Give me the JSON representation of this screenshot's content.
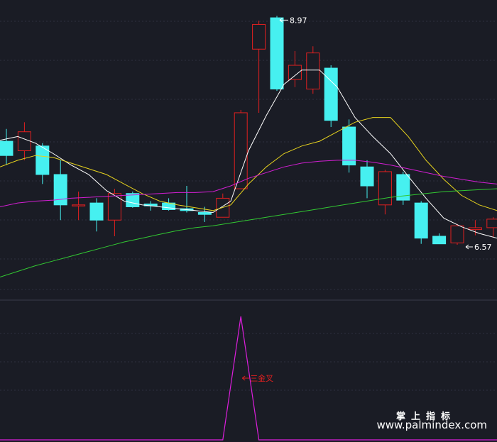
{
  "chart_data": {
    "type": "candlestick",
    "price_range": [
      6.0,
      9.1
    ],
    "candles": [
      {
        "o": 7.65,
        "h": 7.78,
        "l": 7.4,
        "c": 7.5
      },
      {
        "o": 7.55,
        "h": 7.85,
        "l": 7.45,
        "c": 7.75
      },
      {
        "o": 7.6,
        "h": 7.63,
        "l": 7.2,
        "c": 7.3
      },
      {
        "o": 7.3,
        "h": 7.45,
        "l": 6.82,
        "c": 6.98
      },
      {
        "o": 6.98,
        "h": 7.12,
        "l": 6.82,
        "c": 6.98
      },
      {
        "o": 7.0,
        "h": 7.05,
        "l": 6.7,
        "c": 6.82
      },
      {
        "o": 6.82,
        "h": 7.15,
        "l": 6.65,
        "c": 7.1
      },
      {
        "o": 7.1,
        "h": 7.12,
        "l": 6.95,
        "c": 6.96
      },
      {
        "o": 6.99,
        "h": 7.02,
        "l": 6.92,
        "c": 6.97
      },
      {
        "o": 7.0,
        "h": 7.05,
        "l": 6.92,
        "c": 6.93
      },
      {
        "o": 6.94,
        "h": 7.18,
        "l": 6.9,
        "c": 6.92
      },
      {
        "o": 6.9,
        "h": 6.96,
        "l": 6.8,
        "c": 6.88
      },
      {
        "o": 6.85,
        "h": 7.1,
        "l": 6.85,
        "c": 7.05
      },
      {
        "o": 7.15,
        "h": 7.98,
        "l": 7.15,
        "c": 7.95
      },
      {
        "o": 8.62,
        "h": 8.92,
        "l": 7.95,
        "c": 8.88
      },
      {
        "o": 8.95,
        "h": 8.97,
        "l": 8.18,
        "c": 8.2
      },
      {
        "o": 8.3,
        "h": 8.6,
        "l": 8.22,
        "c": 8.45
      },
      {
        "o": 8.2,
        "h": 8.65,
        "l": 8.15,
        "c": 8.58
      },
      {
        "o": 8.42,
        "h": 8.45,
        "l": 7.8,
        "c": 7.87
      },
      {
        "o": 7.8,
        "h": 7.88,
        "l": 7.32,
        "c": 7.4
      },
      {
        "o": 7.38,
        "h": 7.45,
        "l": 7.05,
        "c": 7.18
      },
      {
        "o": 6.98,
        "h": 7.35,
        "l": 6.88,
        "c": 7.33
      },
      {
        "o": 7.3,
        "h": 7.33,
        "l": 6.98,
        "c": 7.03
      },
      {
        "o": 7.0,
        "h": 7.02,
        "l": 6.57,
        "c": 6.63
      },
      {
        "o": 6.65,
        "h": 6.68,
        "l": 6.57,
        "c": 6.57
      },
      {
        "o": 6.58,
        "h": 6.78,
        "l": 6.56,
        "c": 6.76
      },
      {
        "o": 6.72,
        "h": 6.82,
        "l": 6.66,
        "c": 6.74
      },
      {
        "o": 6.74,
        "h": 6.85,
        "l": 6.64,
        "c": 6.83
      }
    ],
    "ma_lines": [
      {
        "color": "#ffffff",
        "values": [
          7.66,
          7.7,
          7.63,
          7.52,
          7.4,
          7.3,
          7.13,
          7.02,
          6.98,
          6.96,
          6.94,
          6.92,
          6.9,
          7.02,
          7.55,
          7.92,
          8.25,
          8.4,
          8.4,
          8.22,
          7.9,
          7.7,
          7.52,
          7.28,
          7.05,
          6.84,
          6.75,
          6.68,
          6.63
        ]
      },
      {
        "color": "#e6d21e",
        "values": [
          7.38,
          7.45,
          7.5,
          7.48,
          7.42,
          7.36,
          7.3,
          7.2,
          7.1,
          7.02,
          6.98,
          6.95,
          6.92,
          6.98,
          7.2,
          7.38,
          7.52,
          7.6,
          7.65,
          7.75,
          7.85,
          7.9,
          7.9,
          7.7,
          7.45,
          7.25,
          7.08,
          6.98,
          6.92
        ]
      },
      {
        "color": "#d21ed2",
        "values": [
          6.96,
          7.0,
          7.02,
          7.03,
          7.05,
          7.06,
          7.07,
          7.08,
          7.09,
          7.1,
          7.11,
          7.11,
          7.12,
          7.18,
          7.26,
          7.32,
          7.38,
          7.42,
          7.44,
          7.45,
          7.45,
          7.43,
          7.4,
          7.36,
          7.32,
          7.28,
          7.25,
          7.22,
          7.2
        ]
      },
      {
        "color": "#32c832",
        "values": [
          6.22,
          6.28,
          6.34,
          6.39,
          6.44,
          6.49,
          6.54,
          6.59,
          6.63,
          6.67,
          6.71,
          6.74,
          6.76,
          6.79,
          6.82,
          6.85,
          6.88,
          6.91,
          6.94,
          6.97,
          7.0,
          7.03,
          7.06,
          7.08,
          7.1,
          7.12,
          7.13,
          7.14,
          7.15
        ]
      }
    ],
    "annotations": {
      "high_label": "8.97",
      "low_label": "6.57"
    },
    "indicator": {
      "values": [
        0,
        0,
        0,
        0,
        0,
        0,
        0,
        0,
        0,
        0,
        0,
        0,
        0,
        1,
        0,
        0,
        0,
        0,
        0,
        0,
        0,
        0,
        0,
        0,
        0,
        0,
        0,
        0
      ],
      "signal_label": "三金叉",
      "color": "#dc1edc"
    },
    "colors": {
      "up": "#e02020",
      "down": "#46f0f0",
      "background": "#1a1c25"
    }
  },
  "branding": {
    "cn": "掌上指标",
    "url": "www.palmindex.com"
  }
}
